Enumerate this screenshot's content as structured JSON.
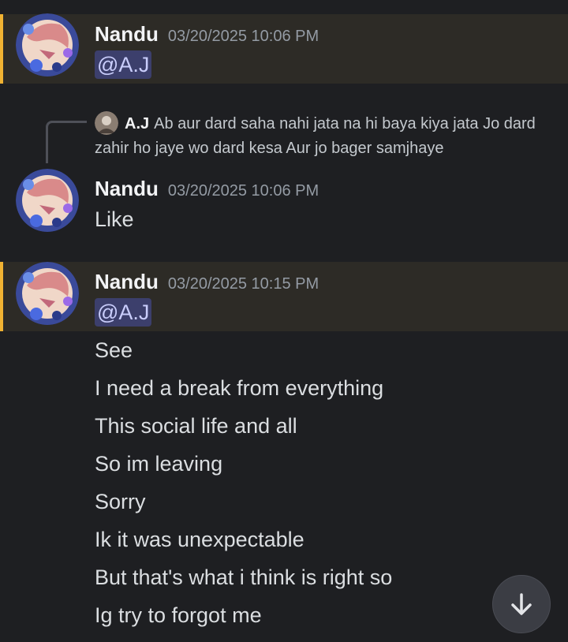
{
  "messages": [
    {
      "username": "Nandu",
      "timestamp": "03/20/2025 10:06 PM",
      "mention": "@A.J"
    },
    {
      "reply": {
        "username": "A.J",
        "text": "Ab aur dard saha nahi jata na hi baya kiya jata  Jo dard zahir ho jaye wo dard kesa  Aur jo bager samjhaye"
      },
      "username": "Nandu",
      "timestamp": "03/20/2025 10:06 PM",
      "lines": [
        "Like"
      ]
    },
    {
      "username": "Nandu",
      "timestamp": "03/20/2025 10:15 PM",
      "mention": "@A.J",
      "lines": [
        "See",
        "I need a break from everything",
        "This social life and all",
        "So im leaving",
        "Sorry",
        "Ik it was unexpectable",
        "But that's what i think is right so",
        "Ig try to forgot me"
      ]
    }
  ],
  "colors": {
    "background": "#1e1f22",
    "mention_highlight": "#2d2b26",
    "mention_bar": "#f0b232",
    "mention_pill": "#c9cdfb"
  },
  "icons": {
    "scroll_button": "arrow-down-icon"
  }
}
